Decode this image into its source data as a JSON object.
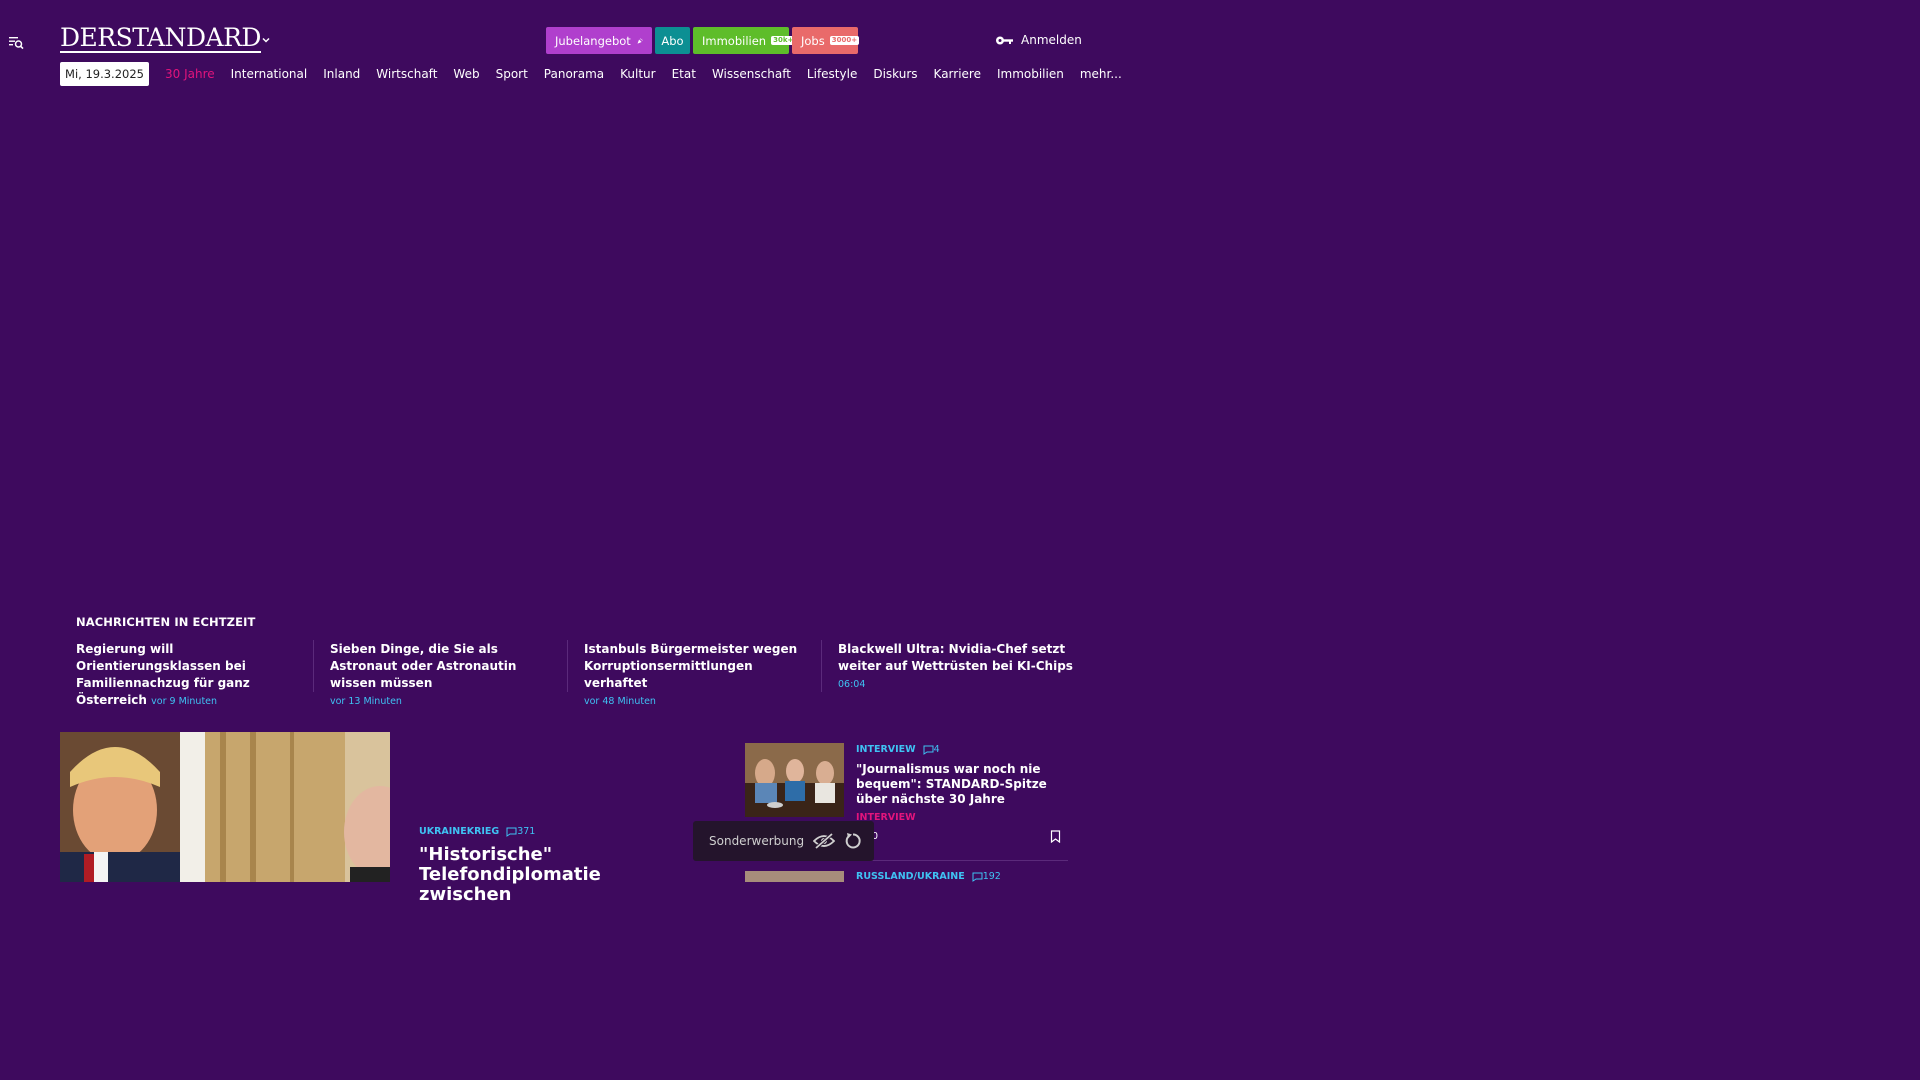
{
  "header": {
    "logo_text": "DERSTANDARD",
    "promos": {
      "jubel": "Jubelangebot",
      "abo": "Abo",
      "immo": "Immobilien",
      "immo_badge": "30k+",
      "jobs": "Jobs",
      "jobs_badge": "3000+"
    },
    "login_label": "Anmelden"
  },
  "nav": {
    "date": "Mi, 19.3.2025",
    "items": [
      "30 Jahre",
      "International",
      "Inland",
      "Wirtschaft",
      "Web",
      "Sport",
      "Panorama",
      "Kultur",
      "Etat",
      "Wissenschaft",
      "Lifestyle",
      "Diskurs",
      "Karriere",
      "Immobilien",
      "mehr..."
    ]
  },
  "realtime": {
    "heading": "NACHRICHTEN IN ECHTZEIT",
    "items": [
      {
        "title": "Regierung will Orientierungsklassen bei Familiennachzug für ganz Österreich",
        "time": "vor 9 Minuten"
      },
      {
        "title": "Sieben Dinge, die Sie als Astronaut oder Astronautin wissen müssen",
        "time": "vor 13 Minuten"
      },
      {
        "title": "Istanbuls Bürgermeister wegen Korruptionsermittlungen verhaftet",
        "time": "vor 48 Minuten"
      },
      {
        "title": "Blackwell Ultra: Nvidia-Chef setzt weiter auf Wettrüsten bei KI-Chips",
        "time": "06:04"
      }
    ]
  },
  "lead": {
    "kicker": "UKRAINEKRIEG",
    "comments": "371",
    "title": "\"Historische\" Telefondiplomatie zwischen"
  },
  "side": {
    "kicker": "INTERVIEW",
    "comments": "4",
    "title": "\"Journalismus war noch nie bequem\": STANDARD-Spitze über nächste 30 Jahre",
    "tag": "INTERVIEW",
    "zero": "0",
    "kicker2": "RUSSLAND/UKRAINE",
    "comments2": "192"
  },
  "ad": {
    "label": "Sonderwerbung"
  },
  "colors": {
    "background": "#3e0a5e",
    "accent_pink": "#e2147c",
    "accent_cyan": "#3fc2f3",
    "promo_purple": "#b03fcd",
    "promo_teal": "#0c8f93",
    "promo_green": "#5ebd2a",
    "promo_red": "#e96a6a"
  }
}
